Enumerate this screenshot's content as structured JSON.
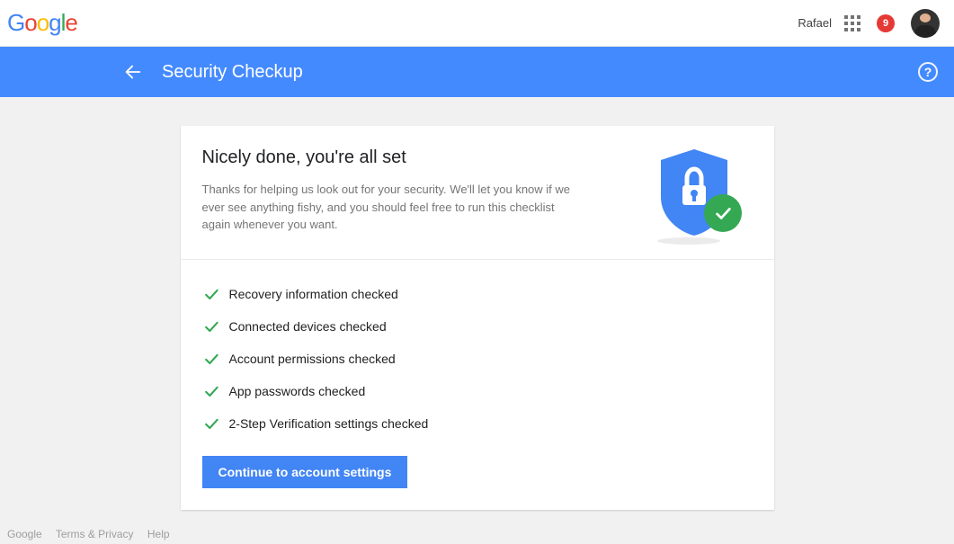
{
  "header": {
    "logo_letters": [
      "G",
      "o",
      "o",
      "g",
      "l",
      "e"
    ],
    "user_name": "Rafael",
    "notification_count": "9"
  },
  "bluebar": {
    "title": "Security Checkup"
  },
  "card": {
    "title": "Nicely done, you're all set",
    "description": "Thanks for helping us look out for your security. We'll let you know if we ever see anything fishy, and you should feel free to run this checklist again whenever you want.",
    "checks": [
      "Recovery information checked",
      "Connected devices checked",
      "Account permissions checked",
      "App passwords checked",
      "2-Step Verification settings checked"
    ],
    "button_label": "Continue to account settings"
  },
  "footer": {
    "link1": "Google",
    "link2": "Terms & Privacy",
    "link3": "Help"
  }
}
